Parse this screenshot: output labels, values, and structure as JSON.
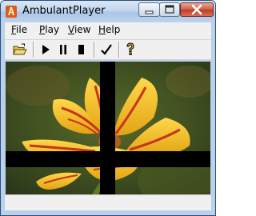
{
  "window": {
    "title": "AmbulantPlayer"
  },
  "menu": {
    "items": [
      {
        "label_first": "F",
        "label_rest": "ile"
      },
      {
        "label_first": "P",
        "label_rest": "lay"
      },
      {
        "label_first": "V",
        "label_rest": "iew"
      },
      {
        "label_first": "H",
        "label_rest": "elp"
      }
    ]
  },
  "toolbar": {
    "buttons": [
      "open-icon",
      "play-icon",
      "pause-icon",
      "stop-icon",
      "checkmark-icon",
      "help-icon"
    ]
  },
  "colors": {
    "titlebar": "#c2d7ee",
    "close_button": "#c23b22",
    "tulip_yellow": "#f1c21d",
    "tulip_red": "#c8341a",
    "background": "#2b3618"
  }
}
